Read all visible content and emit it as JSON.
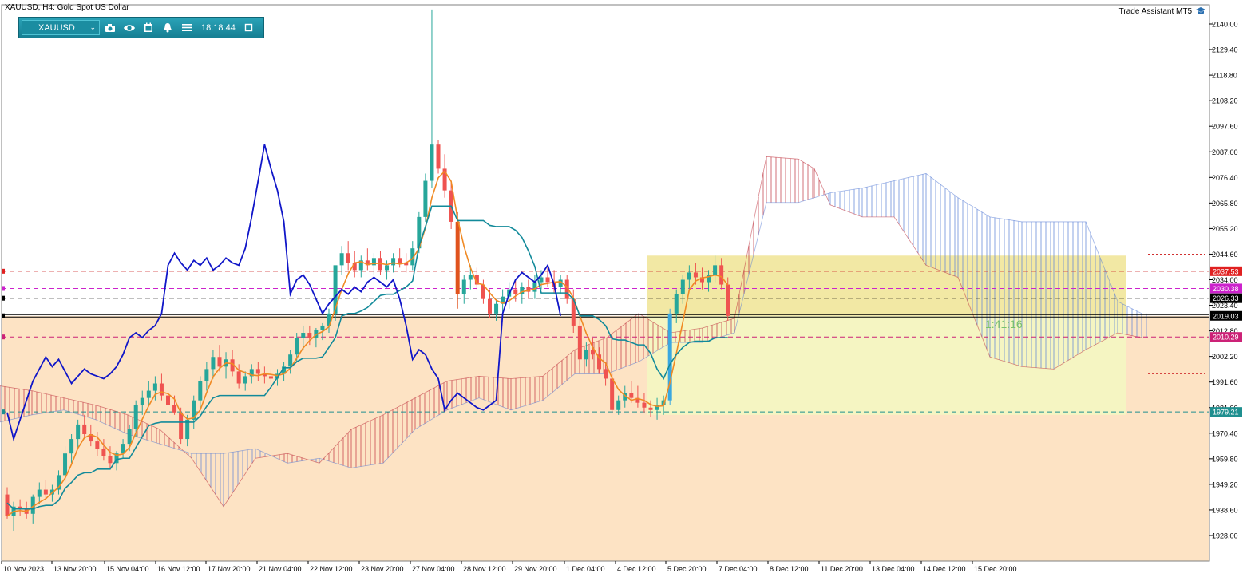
{
  "window": {
    "title": "XAUUSD, H4:  Gold Spot US Dollar",
    "brand": "Trade Assistant MT5"
  },
  "toolbar": {
    "symbol": "XAUUSD",
    "time": "18:18:44",
    "icons": [
      "camera-icon",
      "eye-icon",
      "calendar-icon",
      "alarm-bell-icon",
      "menu-icon",
      "restore-window-icon"
    ]
  },
  "overlay": {
    "countdown": "1:41:16"
  },
  "chart_data": {
    "type": "candlestick",
    "symbol": "XAUUSD",
    "timeframe": "H4",
    "ylim": [
      1919,
      2145
    ],
    "y_ticks": [
      "2140.00",
      "2129.40",
      "2118.80",
      "2108.20",
      "2097.60",
      "2087.00",
      "2076.40",
      "2065.80",
      "2055.20",
      "2044.60",
      "2034.00",
      "2023.40",
      "2012.80",
      "2002.20",
      "1991.60",
      "1981.00",
      "1970.40",
      "1959.80",
      "1949.20",
      "1938.60",
      "1928.00"
    ],
    "x_ticks": [
      "10 Nov 2023",
      "13 Nov 20:00",
      "15 Nov 04:00",
      "16 Nov 12:00",
      "17 Nov 20:00",
      "21 Nov 04:00",
      "22 Nov 12:00",
      "23 Nov 20:00",
      "27 Nov 04:00",
      "28 Nov 12:00",
      "29 Nov 20:00",
      "1 Dec 04:00",
      "4 Dec 12:00",
      "5 Dec 20:00",
      "7 Dec 04:00",
      "8 Dec 12:00",
      "11 Dec 20:00",
      "13 Dec 04:00",
      "14 Dec 12:00",
      "15 Dec 20:00"
    ],
    "price_labels": [
      {
        "value": "2037.53",
        "color": "#e02020"
      },
      {
        "value": "2030.38",
        "color": "#cc22cc"
      },
      {
        "value": "2026.33",
        "color": "#000000"
      },
      {
        "value": "2019.03",
        "color": "#000000"
      },
      {
        "value": "2010.29",
        "color": "#cc2277"
      },
      {
        "value": "1979.21",
        "color": "#1f8f8f"
      }
    ],
    "horizontal_levels": [
      {
        "price": 2037.53,
        "color": "#d03030",
        "style": "dashed"
      },
      {
        "price": 2030.38,
        "color": "#cc22cc",
        "style": "dashed"
      },
      {
        "price": 2026.33,
        "color": "#000000",
        "style": "dashed"
      },
      {
        "price": 2019.03,
        "color": "#000000",
        "style": "solid-double"
      },
      {
        "price": 2010.29,
        "color": "#cc2277",
        "style": "dashed"
      },
      {
        "price": 1979.21,
        "color": "#1f8f8f",
        "style": "dashed"
      }
    ],
    "candles": [
      {
        "o": 1945,
        "h": 1948,
        "l": 1935,
        "c": 1936
      },
      {
        "o": 1936,
        "h": 1942,
        "l": 1930,
        "c": 1940
      },
      {
        "o": 1940,
        "h": 1943,
        "l": 1936,
        "c": 1939
      },
      {
        "o": 1939,
        "h": 1942,
        "l": 1935,
        "c": 1937
      },
      {
        "o": 1937,
        "h": 1945,
        "l": 1933,
        "c": 1944
      },
      {
        "o": 1944,
        "h": 1950,
        "l": 1941,
        "c": 1947
      },
      {
        "o": 1947,
        "h": 1951,
        "l": 1943,
        "c": 1945
      },
      {
        "o": 1945,
        "h": 1949,
        "l": 1942,
        "c": 1947
      },
      {
        "o": 1947,
        "h": 1955,
        "l": 1945,
        "c": 1953
      },
      {
        "o": 1953,
        "h": 1965,
        "l": 1950,
        "c": 1962
      },
      {
        "o": 1962,
        "h": 1970,
        "l": 1958,
        "c": 1968
      },
      {
        "o": 1968,
        "h": 1976,
        "l": 1964,
        "c": 1974
      },
      {
        "o": 1974,
        "h": 1978,
        "l": 1968,
        "c": 1970
      },
      {
        "o": 1970,
        "h": 1974,
        "l": 1965,
        "c": 1967
      },
      {
        "o": 1967,
        "h": 1971,
        "l": 1961,
        "c": 1964
      },
      {
        "o": 1964,
        "h": 1968,
        "l": 1959,
        "c": 1961
      },
      {
        "o": 1961,
        "h": 1965,
        "l": 1956,
        "c": 1958
      },
      {
        "o": 1958,
        "h": 1963,
        "l": 1955,
        "c": 1962
      },
      {
        "o": 1962,
        "h": 1968,
        "l": 1960,
        "c": 1966
      },
      {
        "o": 1966,
        "h": 1974,
        "l": 1963,
        "c": 1972
      },
      {
        "o": 1972,
        "h": 1984,
        "l": 1969,
        "c": 1982
      },
      {
        "o": 1982,
        "h": 1988,
        "l": 1978,
        "c": 1985
      },
      {
        "o": 1985,
        "h": 1992,
        "l": 1982,
        "c": 1988
      },
      {
        "o": 1988,
        "h": 1994,
        "l": 1984,
        "c": 1991
      },
      {
        "o": 1991,
        "h": 1995,
        "l": 1984,
        "c": 1986
      },
      {
        "o": 1986,
        "h": 1990,
        "l": 1980,
        "c": 1982
      },
      {
        "o": 1982,
        "h": 1986,
        "l": 1978,
        "c": 1979
      },
      {
        "o": 1979,
        "h": 1981,
        "l": 1966,
        "c": 1968
      },
      {
        "o": 1968,
        "h": 1978,
        "l": 1965,
        "c": 1976
      },
      {
        "o": 1976,
        "h": 1986,
        "l": 1972,
        "c": 1984
      },
      {
        "o": 1984,
        "h": 1994,
        "l": 1980,
        "c": 1992
      },
      {
        "o": 1992,
        "h": 2000,
        "l": 1988,
        "c": 1997
      },
      {
        "o": 1997,
        "h": 2005,
        "l": 1993,
        "c": 2002
      },
      {
        "o": 2002,
        "h": 2007,
        "l": 1996,
        "c": 1998
      },
      {
        "o": 1998,
        "h": 2004,
        "l": 1993,
        "c": 2001
      },
      {
        "o": 2001,
        "h": 2005,
        "l": 1994,
        "c": 1996
      },
      {
        "o": 1996,
        "h": 1999,
        "l": 1989,
        "c": 1991
      },
      {
        "o": 1991,
        "h": 1996,
        "l": 1988,
        "c": 1994
      },
      {
        "o": 1994,
        "h": 1999,
        "l": 1991,
        "c": 1997
      },
      {
        "o": 1997,
        "h": 2000,
        "l": 1992,
        "c": 1995
      },
      {
        "o": 1995,
        "h": 1998,
        "l": 1991,
        "c": 1994
      },
      {
        "o": 1994,
        "h": 1997,
        "l": 1990,
        "c": 1993
      },
      {
        "o": 1993,
        "h": 1997,
        "l": 1990,
        "c": 1995
      },
      {
        "o": 1995,
        "h": 2000,
        "l": 1992,
        "c": 1998
      },
      {
        "o": 1998,
        "h": 2005,
        "l": 1995,
        "c": 2003
      },
      {
        "o": 2003,
        "h": 2012,
        "l": 2000,
        "c": 2010
      },
      {
        "o": 2010,
        "h": 2015,
        "l": 2005,
        "c": 2012
      },
      {
        "o": 2012,
        "h": 2015,
        "l": 2007,
        "c": 2010
      },
      {
        "o": 2010,
        "h": 2014,
        "l": 2006,
        "c": 2013
      },
      {
        "o": 2013,
        "h": 2016,
        "l": 2009,
        "c": 2015
      },
      {
        "o": 2015,
        "h": 2022,
        "l": 2012,
        "c": 2020
      },
      {
        "o": 2020,
        "h": 2030,
        "l": 2017,
        "c": 2040
      },
      {
        "o": 2040,
        "h": 2048,
        "l": 2036,
        "c": 2045
      },
      {
        "o": 2045,
        "h": 2050,
        "l": 2038,
        "c": 2041
      },
      {
        "o": 2041,
        "h": 2046,
        "l": 2035,
        "c": 2038
      },
      {
        "o": 2038,
        "h": 2044,
        "l": 2035,
        "c": 2042
      },
      {
        "o": 2042,
        "h": 2047,
        "l": 2038,
        "c": 2040
      },
      {
        "o": 2040,
        "h": 2045,
        "l": 2036,
        "c": 2043
      },
      {
        "o": 2043,
        "h": 2046,
        "l": 2036,
        "c": 2038
      },
      {
        "o": 2038,
        "h": 2042,
        "l": 2034,
        "c": 2040
      },
      {
        "o": 2040,
        "h": 2045,
        "l": 2037,
        "c": 2043
      },
      {
        "o": 2043,
        "h": 2047,
        "l": 2039,
        "c": 2041
      },
      {
        "o": 2041,
        "h": 2045,
        "l": 2037,
        "c": 2040
      },
      {
        "o": 2040,
        "h": 2050,
        "l": 2038,
        "c": 2047
      },
      {
        "o": 2047,
        "h": 2062,
        "l": 2045,
        "c": 2060
      },
      {
        "o": 2060,
        "h": 2078,
        "l": 2058,
        "c": 2075
      },
      {
        "o": 2075,
        "h": 2146,
        "l": 2072,
        "c": 2090
      },
      {
        "o": 2090,
        "h": 2092,
        "l": 2078,
        "c": 2080
      },
      {
        "o": 2080,
        "h": 2086,
        "l": 2068,
        "c": 2071
      },
      {
        "o": 2071,
        "h": 2075,
        "l": 2055,
        "c": 2058
      },
      {
        "o": 2058,
        "h": 2062,
        "l": 2022,
        "c": 2028
      },
      {
        "o": 2028,
        "h": 2036,
        "l": 2024,
        "c": 2034
      },
      {
        "o": 2034,
        "h": 2040,
        "l": 2030,
        "c": 2036
      },
      {
        "o": 2036,
        "h": 2039,
        "l": 2030,
        "c": 2032
      },
      {
        "o": 2032,
        "h": 2034,
        "l": 2024,
        "c": 2026
      },
      {
        "o": 2026,
        "h": 2030,
        "l": 2018,
        "c": 2020
      },
      {
        "o": 2020,
        "h": 2026,
        "l": 2017,
        "c": 2024
      },
      {
        "o": 2024,
        "h": 2030,
        "l": 2020,
        "c": 2027
      },
      {
        "o": 2027,
        "h": 2033,
        "l": 2022,
        "c": 2030
      },
      {
        "o": 2030,
        "h": 2034,
        "l": 2025,
        "c": 2028
      },
      {
        "o": 2028,
        "h": 2033,
        "l": 2024,
        "c": 2031
      },
      {
        "o": 2031,
        "h": 2034,
        "l": 2026,
        "c": 2029
      },
      {
        "o": 2029,
        "h": 2036,
        "l": 2026,
        "c": 2033
      },
      {
        "o": 2033,
        "h": 2038,
        "l": 2030,
        "c": 2035
      },
      {
        "o": 2035,
        "h": 2040,
        "l": 2031,
        "c": 2033
      },
      {
        "o": 2033,
        "h": 2038,
        "l": 2028,
        "c": 2031
      },
      {
        "o": 2031,
        "h": 2036,
        "l": 2028,
        "c": 2034
      },
      {
        "o": 2034,
        "h": 2036,
        "l": 2024,
        "c": 2026
      },
      {
        "o": 2026,
        "h": 2030,
        "l": 2012,
        "c": 2015
      },
      {
        "o": 2015,
        "h": 2018,
        "l": 1998,
        "c": 2001
      },
      {
        "o": 2001,
        "h": 2008,
        "l": 1998,
        "c": 2005
      },
      {
        "o": 2005,
        "h": 2010,
        "l": 2001,
        "c": 2003
      },
      {
        "o": 2003,
        "h": 2006,
        "l": 1995,
        "c": 1997
      },
      {
        "o": 1997,
        "h": 2000,
        "l": 1990,
        "c": 1993
      },
      {
        "o": 1993,
        "h": 1995,
        "l": 1979,
        "c": 1980
      },
      {
        "o": 1980,
        "h": 1986,
        "l": 1978,
        "c": 1984
      },
      {
        "o": 1984,
        "h": 1990,
        "l": 1981,
        "c": 1987
      },
      {
        "o": 1987,
        "h": 1992,
        "l": 1983,
        "c": 1985
      },
      {
        "o": 1985,
        "h": 1990,
        "l": 1981,
        "c": 1983
      },
      {
        "o": 1983,
        "h": 1987,
        "l": 1979,
        "c": 1981
      },
      {
        "o": 1981,
        "h": 1984,
        "l": 1977,
        "c": 1980
      },
      {
        "o": 1980,
        "h": 1985,
        "l": 1976,
        "c": 1982
      },
      {
        "o": 1982,
        "h": 1986,
        "l": 1978,
        "c": 1984
      },
      {
        "o": 1984,
        "h": 2022,
        "l": 1982,
        "c": 2020
      },
      {
        "o": 2020,
        "h": 2030,
        "l": 2016,
        "c": 2028
      },
      {
        "o": 2028,
        "h": 2036,
        "l": 2024,
        "c": 2034
      },
      {
        "o": 2034,
        "h": 2040,
        "l": 2030,
        "c": 2037
      },
      {
        "o": 2037,
        "h": 2041,
        "l": 2032,
        "c": 2035
      },
      {
        "o": 2035,
        "h": 2039,
        "l": 2030,
        "c": 2033
      },
      {
        "o": 2033,
        "h": 2038,
        "l": 2029,
        "c": 2036
      },
      {
        "o": 2036,
        "h": 2044,
        "l": 2033,
        "c": 2040
      },
      {
        "o": 2040,
        "h": 2043,
        "l": 2030,
        "c": 2032
      },
      {
        "o": 2032,
        "h": 2035,
        "l": 2017,
        "c": 2019
      }
    ],
    "current_price": 2019.03,
    "colors": {
      "bull": "#26a69a",
      "bear": "#ef5350",
      "bull_tall": "#3aa8e0",
      "bear_tall": "#e0531d"
    }
  }
}
